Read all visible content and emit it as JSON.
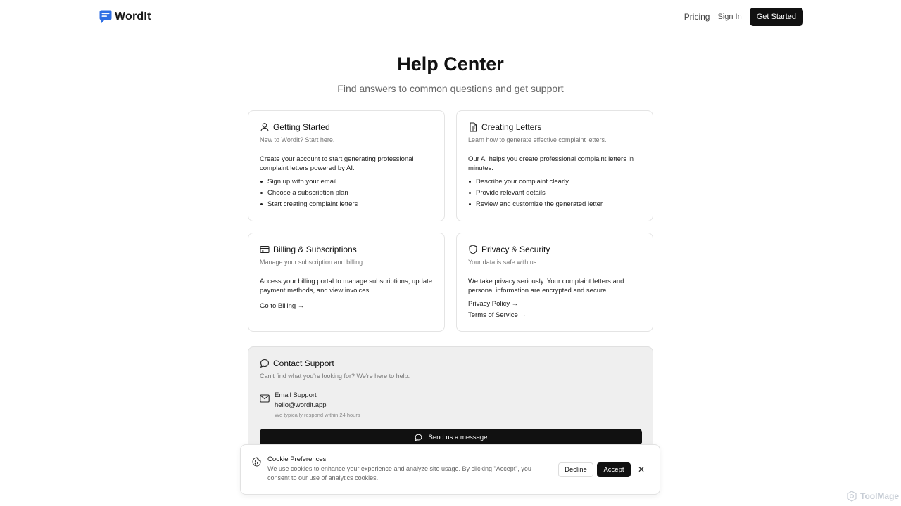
{
  "header": {
    "logo_text": "WordIt",
    "nav": {
      "pricing": "Pricing",
      "sign_in": "Sign In",
      "get_started": "Get Started"
    }
  },
  "hero": {
    "title": "Help Center",
    "subtitle": "Find answers to common questions and get support"
  },
  "cards": [
    {
      "icon": "user-icon",
      "title": "Getting Started",
      "description": "New to WordIt? Start here.",
      "body": "Create your account to start generating professional complaint letters powered by AI.",
      "list": [
        "Sign up with your email",
        "Choose a subscription plan",
        "Start creating complaint letters"
      ]
    },
    {
      "icon": "document-icon",
      "title": "Creating Letters",
      "description": "Learn how to generate effective complaint letters.",
      "body": "Our AI helps you create professional complaint letters in minutes.",
      "list": [
        "Describe your complaint clearly",
        "Provide relevant details",
        "Review and customize the generated letter"
      ]
    },
    {
      "icon": "credit-card-icon",
      "title": "Billing & Subscriptions",
      "description": "Manage your subscription and billing.",
      "body": "Access your billing portal to manage subscriptions, update payment methods, and view invoices.",
      "links": [
        "Go to Billing →"
      ]
    },
    {
      "icon": "shield-icon",
      "title": "Privacy & Security",
      "description": "Your data is safe with us.",
      "body": "We take privacy seriously. Your complaint letters and personal information are encrypted and secure.",
      "links": [
        "Privacy Policy →",
        "Terms of Service →"
      ]
    }
  ],
  "support": {
    "title": "Contact Support",
    "description": "Can't find what you're looking for? We're here to help.",
    "email_title": "Email Support",
    "email_address": "hello@wordit.app",
    "email_note": "We typically respond within 24 hours",
    "button_label": "Send us a message"
  },
  "cookie": {
    "title": "Cookie Preferences",
    "text": "We use cookies to enhance your experience and analyze site usage. By clicking \"Accept\", you consent to our use of analytics cookies.",
    "decline": "Decline",
    "accept": "Accept",
    "close": "✕"
  },
  "watermark": "ToolMage",
  "colors": {
    "brand_blue": "#2f6fe4",
    "primary_dark": "#111111",
    "muted_text": "#777777"
  }
}
